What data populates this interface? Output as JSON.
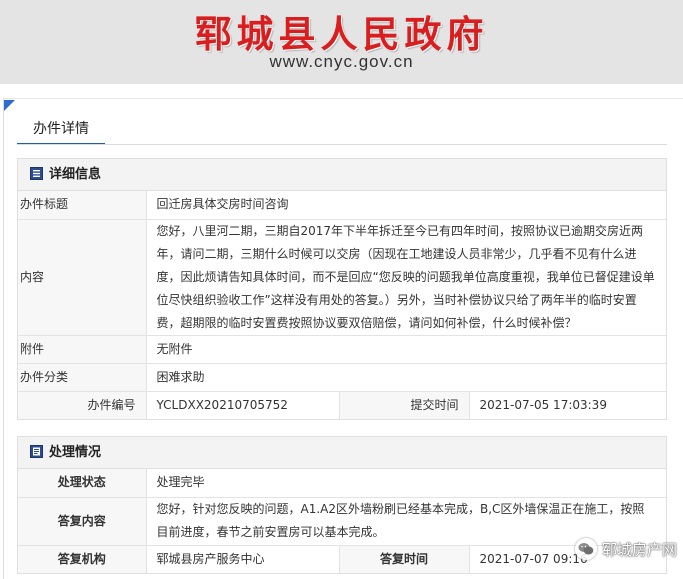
{
  "header": {
    "site_name": "郓城县人民政府",
    "url": "www.cnyc.gov.cn"
  },
  "tab": {
    "label": "办件详情"
  },
  "detail": {
    "title": "详细信息",
    "rows": {
      "subject_label": "办件标题",
      "subject": "回迁房具体交房时间咨询",
      "content_label": "内容",
      "content": "您好，八里河二期，三期自2017年下半年拆迁至今已有四年时间，按照协议已逾期交房近两年，请问二期，三期什么时候可以交房（因现在工地建设人员非常少，几乎看不见有什么进度，因此烦请告知具体时间，而不是回应“您反映的问题我单位高度重视，我单位已督促建设单位尽快组织验收工作”这样没有用处的答复。）另外，当时补偿协议只给了两年半的临时安置费，超期限的临时安置费按照协议要双倍赔偿，请问如何补偿，什么时候补偿？",
      "attachment_label": "附件",
      "attachment": "无附件",
      "category_label": "办件分类",
      "category": "困难求助",
      "number_label": "办件编号",
      "number": "YCLDXX20210705752",
      "submit_time_label": "提交时间",
      "submit_time": "2021-07-05 17:03:39"
    }
  },
  "handling": {
    "title": "处理情况",
    "rows": {
      "status_label": "处理状态",
      "status": "处理完毕",
      "reply_label": "答复内容",
      "reply": "您好，针对您反映的问题，A1.A2区外墙粉刷已经基本完成，B,C区外墙保温正在施工，按照目前进度，春节之前安置房可以基本完成。",
      "org_label": "答复机构",
      "org": "郓城县房产服务中心",
      "reply_time_label": "答复时间",
      "reply_time": "2021-07-07 09:16"
    }
  },
  "watermark": {
    "text": "郓城房产网"
  },
  "colors": {
    "brand_red": "#d81e1e",
    "accent_blue": "#1d5db5"
  }
}
